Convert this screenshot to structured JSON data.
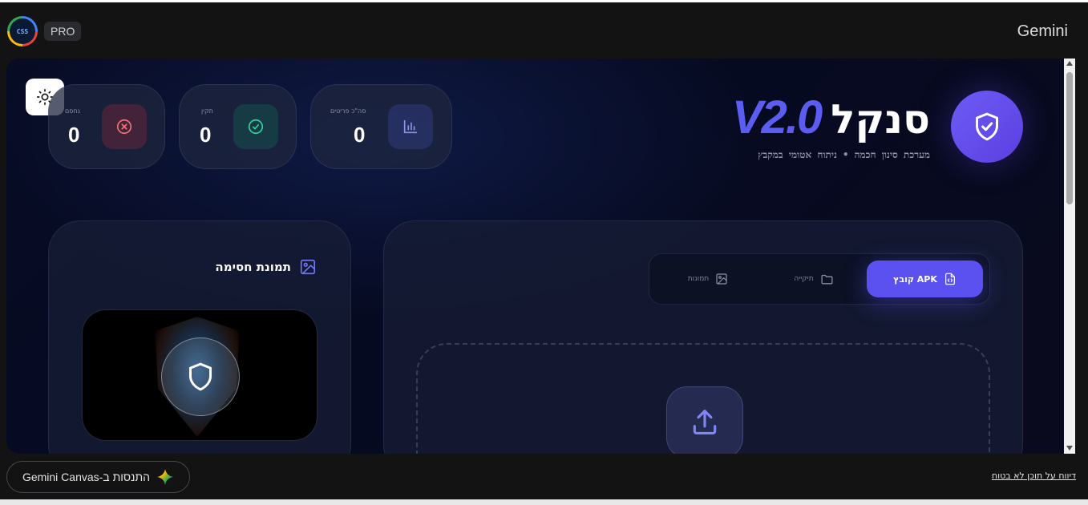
{
  "topbar": {
    "logo_text": "CSS",
    "pro_badge": "PRO",
    "brand": "Gemini"
  },
  "app": {
    "title_name": "סנקל",
    "title_version": "V2.0",
    "subtitle": "מערכת סינון חכמה • ניתוח אטומי במקבץ",
    "stats": [
      {
        "label": "סה\"כ פריטים",
        "value": "0",
        "icon": "bar-chart-icon",
        "color": "#8c96e8"
      },
      {
        "label": "תקין",
        "value": "0",
        "icon": "check-circle-icon",
        "color": "#34d399"
      },
      {
        "label": "נחסם",
        "value": "0",
        "icon": "x-circle-icon",
        "color": "#f87171"
      }
    ],
    "block_image": {
      "title": "תמונת חסימה"
    },
    "tabs": [
      {
        "label": "קובץ APK",
        "icon": "file-code-icon",
        "active": true
      },
      {
        "label": "תיקייה",
        "icon": "folder-icon",
        "active": false
      },
      {
        "label": "תמונות",
        "icon": "image-icon",
        "active": false
      }
    ],
    "accent": "#5b50f0"
  },
  "bottombar": {
    "try_canvas": "התנסות ב-Gemini Canvas",
    "report_link": "דיווח על תוכן לא בטוח"
  }
}
